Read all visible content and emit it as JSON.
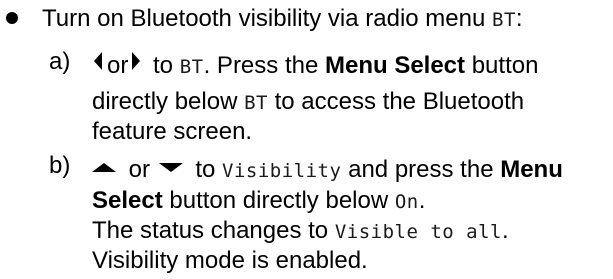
{
  "bullet": {
    "text_before": "Turn on Bluetooth visibility via radio menu ",
    "code": "BT",
    "text_after": ":"
  },
  "step_a": {
    "marker": "a)",
    "or_text": "or",
    "line1_text1": " to ",
    "line1_code": "BT",
    "line1_text2": ". Press the ",
    "line1_bold": "Menu Select",
    "line1_text3": " button",
    "line2_text1": "directly below ",
    "line2_code": "BT",
    "line2_text2": " to access the Bluetooth",
    "line3_text": "feature screen."
  },
  "step_b": {
    "marker": "b)",
    "line1_text1": " or ",
    "line1_text2": " to ",
    "line1_code": "Visibility",
    "line1_text3": " and press the ",
    "line1_bold": "Menu",
    "line2_bold": "Select",
    "line2_text1": " button directly below ",
    "line2_code": "On",
    "line2_text2": ".",
    "line3_text1": "The status changes to ",
    "line3_code": "Visible to all",
    "line3_text2": ".",
    "line4_text": "Visibility mode is enabled."
  },
  "icons": {
    "left": "left-arrow-icon",
    "right": "right-arrow-icon",
    "up": "up-arrow-icon",
    "down": "down-arrow-icon"
  }
}
